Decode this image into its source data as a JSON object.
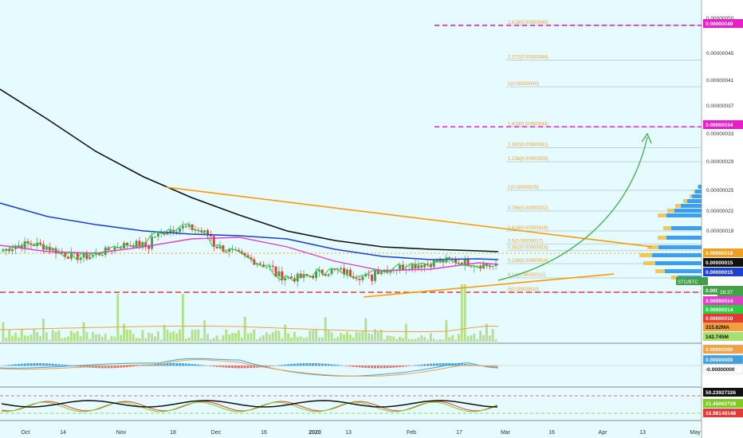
{
  "colors": {
    "background": "#e6fbff",
    "axis_bg": "#ffffff",
    "candle_up": "#43a047",
    "candle_down": "#e53935",
    "ema_black": "#111111",
    "ema_blue": "#1e40d0",
    "ema_magenta": "#e040c8",
    "ema_green": "#2ecc40",
    "trendline": "#ff9800",
    "arrow": "#3cb043",
    "target_line": "#e91ec8",
    "support_line": "#e53935",
    "fib_text": "#f0a030",
    "volume_bar": "#b4e08c",
    "macd_blue": "#3fa0e0",
    "macd_orange": "#f0a040",
    "rsi_black": "#111111",
    "rsi_red": "#e53935",
    "rsi_green": "#7ccc22"
  },
  "chart_data": {
    "type": "candlestick",
    "symbol_tag": "STC/BTC",
    "x_ticks": [
      "Oct",
      "14",
      "Nov",
      "18",
      "Dec",
      "16",
      "2020",
      "13",
      "Feb",
      "17",
      "Mar",
      "16",
      "Apr",
      "13",
      "May"
    ],
    "y_ticks": [
      "0.00000050",
      "0.00000045",
      "0.00000041",
      "0.00000037",
      "0.00000033",
      "0.00000029",
      "0.00000025",
      "0.00000022",
      "0.00000019",
      "0.00000010"
    ],
    "fib_levels": [
      {
        "label": "2.618(0.00000049)",
        "value": 4.9e-07
      },
      {
        "label": "2.272(0.00000044)",
        "value": 4.4e-07
      },
      {
        "label": "2(0.00000040)",
        "value": 4e-07
      },
      {
        "label": "1.618(0.00000034)",
        "value": 3.4e-07
      },
      {
        "label": "1.382(0.00000031)",
        "value": 3.1e-07
      },
      {
        "label": "1.236(0.00000029)",
        "value": 2.9e-07
      },
      {
        "label": "1(0.00000025)",
        "value": 2.5e-07
      },
      {
        "label": "0.786(0.00000022)",
        "value": 2.2e-07
      },
      {
        "label": "0.618(0.00000019)",
        "value": 1.9e-07
      },
      {
        "label": "0.5(0.00000017)",
        "value": 1.7e-07
      },
      {
        "label": "0.382(0.00000016)",
        "value": 1.6e-07
      },
      {
        "label": "0.236(0.00000014)",
        "value": 1.4e-07
      },
      {
        "label": "0.14(0.00000012)",
        "value": 1.2e-07
      },
      {
        "label": "0(0.00000010)",
        "value": 1e-07
      }
    ],
    "price_badges": [
      {
        "text": "0.00000049",
        "color": "#e91ec8"
      },
      {
        "text": "0.00000034",
        "color": "#e91ec8"
      },
      {
        "text": "0.00000016",
        "color": "#f0a020"
      },
      {
        "text": "0.00000015",
        "color": "#111111"
      },
      {
        "text": "0.00000015",
        "color": "#1e40d0"
      },
      {
        "text": "0.00000014",
        "color": "#43a047"
      },
      {
        "text": "0.00000014",
        "color": "#e040c8"
      },
      {
        "text": "0.00000014",
        "color": "#2ecc40"
      },
      {
        "text": "0.00000010",
        "color": "#e53935"
      }
    ],
    "countdown": "28:37",
    "volume_badges": [
      {
        "text": "315.62MA",
        "color": "#f0a040"
      },
      {
        "text": "142.745M",
        "color": "#a8e070"
      }
    ],
    "macd_badges": [
      {
        "text": "0.00000000",
        "color": "#f0a040"
      },
      {
        "text": "0.00000000",
        "color": "#3fa0e0"
      },
      {
        "text": "-0.00000000",
        "color": "#ffffff"
      }
    ],
    "rsi_badges": [
      {
        "text": "50.23927326",
        "color": "#111111"
      },
      {
        "text": "21.45062728",
        "color": "#7ccc22"
      },
      {
        "text": "18.98148148",
        "color": "#e53935"
      }
    ],
    "y_axis_range": [
      8e-08,
      5.2e-07
    ]
  }
}
